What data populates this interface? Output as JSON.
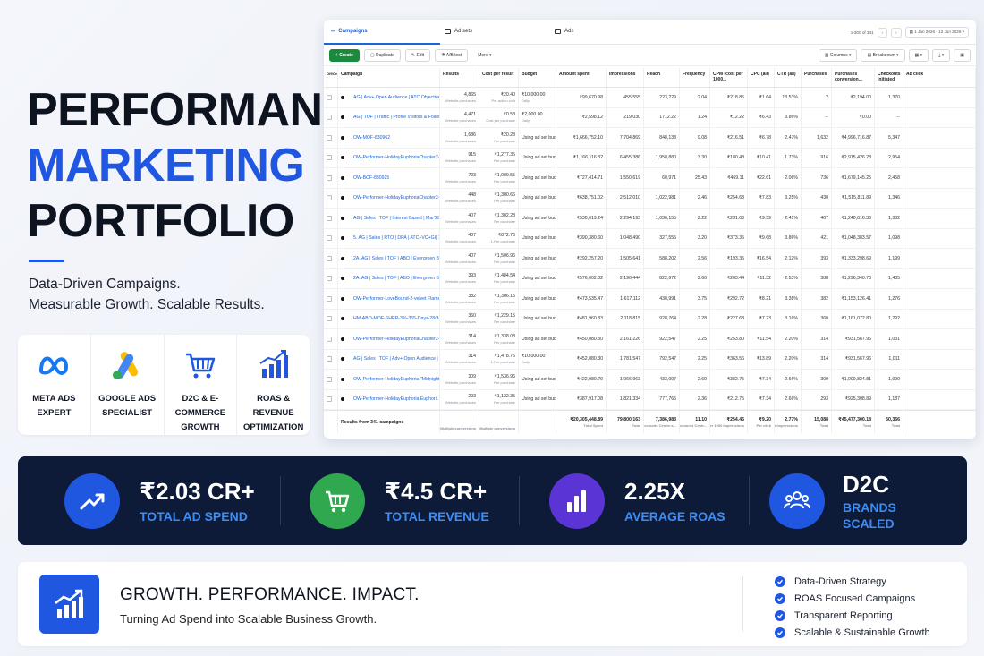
{
  "hero": {
    "line1": "PERFORMANCE",
    "line2": "MARKETING",
    "line3": "PORTFOLIO",
    "sub1": "Data-Driven Campaigns.",
    "sub2": "Measurable Growth. Scalable Results."
  },
  "badges": [
    {
      "icon": "meta-icon",
      "l1": "META ADS",
      "l2": "EXPERT"
    },
    {
      "icon": "google-ads-icon",
      "l1": "GOOGLE ADS",
      "l2": "SPECIALIST"
    },
    {
      "icon": "cart-icon",
      "l1": "D2C & E-COMMERCE",
      "l2": "GROWTH"
    },
    {
      "icon": "chart-icon",
      "l1": "ROAS & REVENUE",
      "l2": "OPTIMIZATION"
    }
  ],
  "ads_manager": {
    "tabs": [
      "Campaigns",
      "Ad sets",
      "Ads"
    ],
    "range": "1-300 of 341",
    "date": "1 Jan 2026 - 13 Jun 2026",
    "toolbar": {
      "create": "+ Create",
      "duplicate": "Duplicate",
      "edit": "Edit",
      "ab": "A/B test",
      "more": "More",
      "columns": "Columns",
      "breakdown": "Breakdown"
    },
    "headers": [
      "Off/On",
      "Campaign",
      "Results",
      "Cost per result",
      "Budget",
      "Amount spent",
      "Impressions",
      "Reach",
      "Frequency",
      "CPM (cost per 1000...",
      "CPC (all)",
      "CTR (all)",
      "Purchases",
      "Purchases conversion...",
      "Checkouts initiated",
      "Ad click"
    ],
    "rows": [
      {
        "name": "AG | Adv+ Open Audience | ATC Objective | [SSS...",
        "results": "4,865",
        "rsub": "Website purchases",
        "cpr": "₹20.40",
        "cprsub": "Per action cost",
        "budget": "₹10,000.00",
        "bsub": "Daily",
        "spent": "₹99,670.98",
        "impr": "455,555",
        "reach": "223,229",
        "freq": "2.04",
        "cpm": "₹218.85",
        "cpc": "₹1.64",
        "ctr": "13.53%",
        "purch": "2",
        "pconv": "₹2,194.00",
        "chk": "1,370"
      },
      {
        "name": "AG | TOF | Traffic | Profile Visitors & Followers | M...",
        "results": "4,471",
        "rsub": "Website purchases",
        "cpr": "₹0.58",
        "cprsub": "Cost per purchase",
        "budget": "₹2,000.00",
        "bsub": "Daily",
        "spent": "₹2,598.12",
        "impr": "219,030",
        "reach": "1712.22",
        "freq": "1.24",
        "cpm": "₹12.22",
        "cpc": "₹6.43",
        "ctr": "3.86%",
        "purch": "--",
        "pconv": "₹0.00",
        "chk": "--"
      },
      {
        "name": "OW-MOF-830962",
        "results": "1,686",
        "rsub": "Website purchases",
        "cpr": "₹20.28",
        "cprsub": "Per purchase",
        "budget": "Using ad set bud...",
        "bsub": "",
        "spent": "₹1,666,752.10",
        "impr": "7,704,869",
        "reach": "848,138",
        "freq": "9.08",
        "cpm": "₹216.51",
        "cpc": "₹6.78",
        "ctr": "2.47%",
        "purch": "1,632",
        "pconv": "₹4,996,716.87",
        "chk": "5,347"
      },
      {
        "name": "OW-Performer-HolidayEuphoriaChapter2-Paral...",
        "results": "915",
        "rsub": "Website purchases",
        "cpr": "₹1,277.35",
        "cprsub": "Per purchase",
        "budget": "Using ad set bud...",
        "bsub": "",
        "spent": "₹1,166,116.32",
        "impr": "6,455,386",
        "reach": "1,958,880",
        "freq": "3.30",
        "cpm": "₹180.48",
        "cpc": "₹10.41",
        "ctr": "1.73%",
        "purch": "916",
        "pconv": "₹2,915,426.28",
        "chk": "2,954"
      },
      {
        "name": "OW-BOF-830925",
        "results": "723",
        "rsub": "Website purchases",
        "cpr": "₹1,009.55",
        "cprsub": "Per purchase",
        "budget": "Using ad set bud...",
        "bsub": "",
        "spent": "₹727,414.71",
        "impr": "1,550,619",
        "reach": "60,971",
        "freq": "25.43",
        "cpm": "₹469.11",
        "cpc": "₹22.61",
        "ctr": "2.06%",
        "purch": "736",
        "pconv": "₹1,679,145.25",
        "chk": "2,468"
      },
      {
        "name": "OW-Performer-HolidayEuphoriaChapter2-Pando...",
        "results": "448",
        "rsub": "Website purchases",
        "cpr": "₹1,300.66",
        "cprsub": "Per purchase",
        "budget": "Using ad set bud...",
        "bsub": "",
        "spent": "₹638,751.02",
        "impr": "2,512,010",
        "reach": "1,022,981",
        "freq": "2.46",
        "cpm": "₹254.68",
        "cpc": "₹7.83",
        "ctr": "3.25%",
        "purch": "430",
        "pconv": "₹1,515,811.89",
        "chk": "1,346"
      },
      {
        "name": "AG | Sales | TOF | Interest Based | Mar'26",
        "results": "407",
        "rsub": "Website purchases",
        "cpr": "₹1,302.28",
        "cprsub": "Per purchase",
        "budget": "Using ad set bud...",
        "bsub": "",
        "spent": "₹530,019.24",
        "impr": "2,294,193",
        "reach": "1,036,155",
        "freq": "2.22",
        "cpm": "₹231.03",
        "cpc": "₹9.59",
        "ctr": "2.41%",
        "purch": "407",
        "pconv": "₹1,240,616.36",
        "chk": "1,382"
      },
      {
        "name": "5. AG | Sales | RTO | DPA | ATC+VC+GI| 180-300...",
        "results": "407",
        "rsub": "Website purchases",
        "cpr": "₹872.73",
        "cprsub": "1-Per purchase",
        "budget": "Using ad set bud...",
        "bsub": "",
        "spent": "₹390,380.60",
        "impr": "1,048,490",
        "reach": "327,555",
        "freq": "3.20",
        "cpm": "₹373.35",
        "cpc": "₹9.68",
        "ctr": "3.86%",
        "purch": "421",
        "pconv": "₹1,048,383.57",
        "chk": "1,098"
      },
      {
        "name": "2A. AG | Sales | TOF | ABO | Evergreen Bestseller...",
        "results": "407",
        "rsub": "Website purchases",
        "cpr": "₹1,506.96",
        "cprsub": "Per purchase",
        "budget": "Using ad set bud...",
        "bsub": "",
        "spent": "₹292,257.20",
        "impr": "1,505,641",
        "reach": "588,202",
        "freq": "2.56",
        "cpm": "₹193.35",
        "cpc": "₹16.54",
        "ctr": "2.12%",
        "purch": "393",
        "pconv": "₹1,333,298.69",
        "chk": "1,199"
      },
      {
        "name": "2A. AG | Sales | TOF | ABO | Evergreen Bestseller...",
        "results": "393",
        "rsub": "Website purchases",
        "cpr": "₹1,484.54",
        "cprsub": "Per purchase",
        "budget": "Using ad set bud...",
        "bsub": "",
        "spent": "₹576,002.02",
        "impr": "2,196,444",
        "reach": "822,672",
        "freq": "2.66",
        "cpm": "₹263.44",
        "cpc": "₹11.32",
        "ctr": "2.53%",
        "purch": "388",
        "pconv": "₹1,296,340.73",
        "chk": "1,435"
      },
      {
        "name": "OW-Performer-LoveBound-2-velvet Flame Scrap...",
        "results": "382",
        "rsub": "Website purchases",
        "cpr": "₹1,306.15",
        "cprsub": "Per purchase",
        "budget": "Using ad set bud...",
        "bsub": "",
        "spent": "₹473,535.47",
        "impr": "1,617,112",
        "reach": "430,991",
        "freq": "3.75",
        "cpm": "₹292.72",
        "cpc": "₹8.21",
        "ctr": "3.38%",
        "purch": "382",
        "pconv": "₹1,153,126.41",
        "chk": "1,276"
      },
      {
        "name": "HM-ABO-MOF-SHRR-3%-365-Days-28/3/26",
        "results": "360",
        "rsub": "Website purchases",
        "cpr": "₹1,229.15",
        "cprsub": "Per purchase",
        "budget": "Using ad set bud...",
        "bsub": "",
        "spent": "₹481,960.83",
        "impr": "2,118,815",
        "reach": "928,764",
        "freq": "2.28",
        "cpm": "₹227.68",
        "cpc": "₹7.23",
        "ctr": "3.16%",
        "purch": "360",
        "pconv": "₹1,161,072.80",
        "chk": "1,292"
      },
      {
        "name": "OW-Performer-HolidayEuphoriaChapter2-Aem...",
        "results": "314",
        "rsub": "Website purchases",
        "cpr": "₹1,338.08",
        "cprsub": "Per purchase",
        "budget": "Using ad set bud...",
        "bsub": "",
        "spent": "₹450,080.30",
        "impr": "2,161,226",
        "reach": "922,547",
        "freq": "2.25",
        "cpm": "₹253.80",
        "cpc": "₹11.54",
        "ctr": "2.20%",
        "purch": "314",
        "pconv": "₹931,567.96",
        "chk": "1,031"
      },
      {
        "name": "AG | Sales | TOF | Adv+ Open Audience | Perform...",
        "results": "314",
        "rsub": "Website purchases",
        "cpr": "₹1,478.75",
        "cprsub": "1-Per purchase",
        "budget": "₹10,000.00",
        "bsub": "Daily",
        "spent": "₹452,080.30",
        "impr": "1,781,547",
        "reach": "792,547",
        "freq": "2.25",
        "cpm": "₹363.56",
        "cpc": "₹13.89",
        "ctr": "2.20%",
        "purch": "314",
        "pconv": "₹931,567.96",
        "chk": "1,011"
      },
      {
        "name": "OW-Performer-HolidayEuphoria \"Midnight\" Velv...",
        "results": "309",
        "rsub": "Website purchases",
        "cpr": "₹1,536.96",
        "cprsub": "Per purchase",
        "budget": "Using ad set bud...",
        "bsub": "",
        "spent": "₹422,080.79",
        "impr": "1,066,963",
        "reach": "433,097",
        "freq": "2.69",
        "cpm": "₹382.75",
        "cpc": "₹7.34",
        "ctr": "2.66%",
        "purch": "309",
        "pconv": "₹1,000,824.81",
        "chk": "1,090"
      },
      {
        "name": "OW-Performer-HolidayEuphoria Euphori...",
        "results": "293",
        "rsub": "Website purchases",
        "cpr": "₹1,122.35",
        "cprsub": "Per purchase",
        "budget": "Using ad set bud...",
        "bsub": "",
        "spent": "₹387,917.08",
        "impr": "1,821,334",
        "reach": "777,765",
        "freq": "2.36",
        "cpm": "₹212.75",
        "cpc": "₹7.34",
        "ctr": "2.66%",
        "purch": "293",
        "pconv": "₹925,308.89",
        "chk": "1,187"
      }
    ],
    "footer": {
      "label": "Results from 341 campaigns",
      "r": "Multiple conversions",
      "cpr": "Multiple conversions",
      "spent": "₹20,305,448.89",
      "spentsub": "Total Spent",
      "impr": "79,800,163",
      "imprsub": "Total",
      "reach": "7,386,983",
      "reachsub": "Accounts Centre a...",
      "freq": "11.10",
      "freqsub": "Per Accounts Centr...",
      "cpm": "₹254.45",
      "cpmsub": "Per 1000 Impressions",
      "cpc": "₹9.20",
      "cpcsub": "Per click",
      "ctr": "2.77%",
      "ctrsub": "Per Impressions",
      "purch": "15,088",
      "purchsub": "Total",
      "pconv": "₹45,477,300.18",
      "pconvsub": "Total",
      "chk": "50,356",
      "chksub": "Total"
    }
  },
  "stats": [
    {
      "icon": "trend-up-icon",
      "color": "#1f57e0",
      "value": "₹2.03 CR+",
      "label": "TOTAL AD SPEND"
    },
    {
      "icon": "cart-icon",
      "color": "#2fa84f",
      "value": "₹4.5 CR+",
      "label": "TOTAL REVENUE"
    },
    {
      "icon": "bar-chart-icon",
      "color": "#5b34d6",
      "value": "2.25X",
      "label": "AVERAGE ROAS"
    },
    {
      "icon": "users-icon",
      "color": "#1f57e0",
      "value": "D2C",
      "label": "BRANDS",
      "label2": "SCALED"
    }
  ],
  "bottom": {
    "title": "GROWTH. PERFORMANCE. IMPACT.",
    "sub": "Turning Ad Spend into Scalable Business Growth.",
    "points": [
      "Data-Driven Strategy",
      "ROAS Focused Campaigns",
      "Transparent Reporting",
      "Scalable & Sustainable Growth"
    ]
  },
  "colors": {
    "brand_blue": "#1f57e0",
    "navy": "#0d1a38",
    "green": "#2fa84f",
    "purple": "#5b34d6",
    "fb_blue": "#1d64d8"
  }
}
